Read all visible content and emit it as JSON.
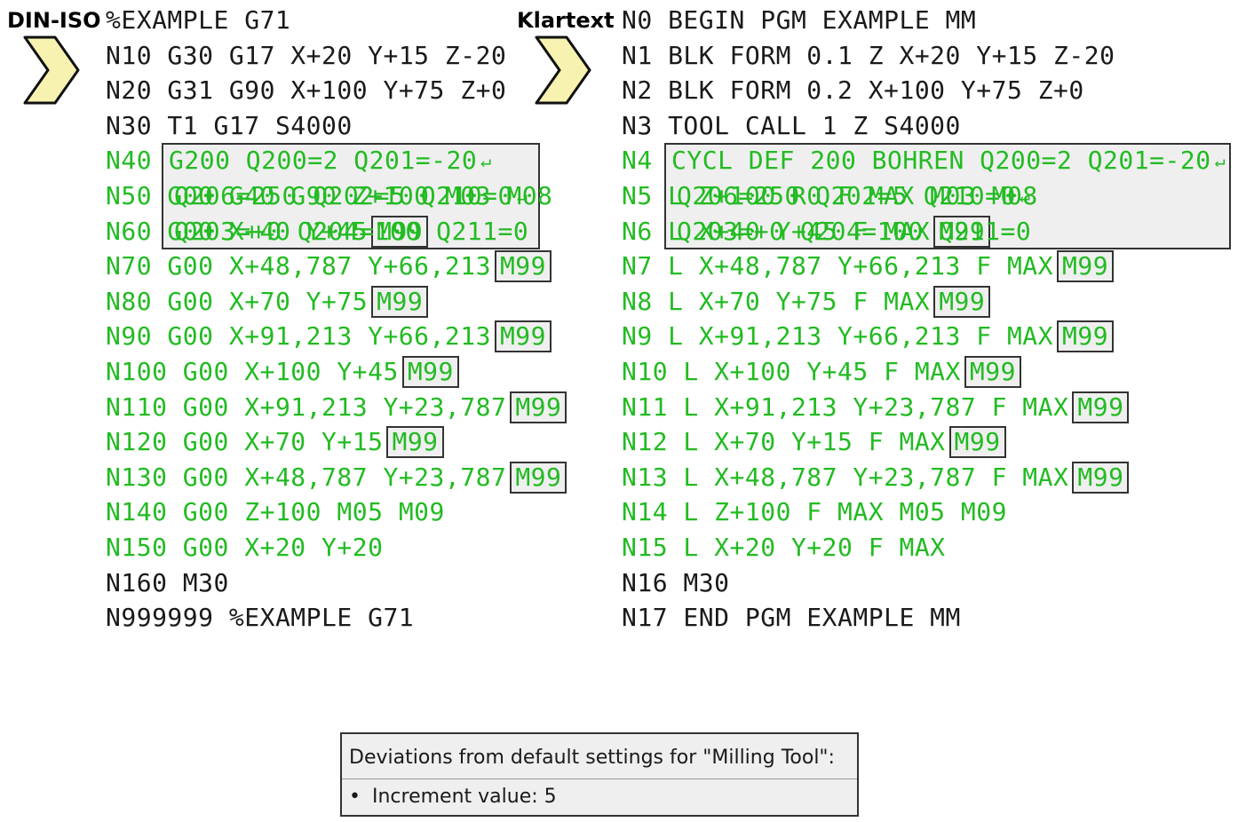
{
  "left": {
    "label": "DIN-ISO",
    "cycle_box": [
      [
        "G200",
        "Q200=2",
        "Q201=-20"
      ],
      [
        "Q206=250",
        "Q202=5",
        "Q210=0"
      ],
      [
        "Q203=+0",
        "Q204=100",
        "Q211=0"
      ]
    ],
    "lines": [
      {
        "color": "black",
        "tokens": [
          "%EXAMPLE",
          "G71"
        ]
      },
      {
        "color": "black",
        "tokens": [
          "N10",
          "G30",
          "G17",
          "X+20",
          "Y+15",
          "Z-20"
        ]
      },
      {
        "color": "black",
        "tokens": [
          "N20",
          "G31",
          "G90",
          "X+100",
          "Y+75",
          "Z+0"
        ]
      },
      {
        "color": "black",
        "tokens": [
          "N30",
          "T1",
          "G17",
          "S4000"
        ]
      },
      {
        "color": "green",
        "tokens": [
          "N40"
        ]
      },
      {
        "color": "green",
        "tokens": [
          "N50",
          "G00",
          "G40",
          "G90",
          "Z+100",
          "M03",
          "M08"
        ]
      },
      {
        "color": "green",
        "tokens": [
          "N60",
          "G00",
          "X+40",
          "Y+45"
        ],
        "boxed": "M99"
      },
      {
        "color": "green",
        "tokens": [
          "N70",
          "G00",
          "X+48,787",
          "Y+66,213"
        ],
        "boxed": "M99"
      },
      {
        "color": "green",
        "tokens": [
          "N80",
          "G00",
          "X+70",
          "Y+75"
        ],
        "boxed": "M99"
      },
      {
        "color": "green",
        "tokens": [
          "N90",
          "G00",
          "X+91,213",
          "Y+66,213"
        ],
        "boxed": "M99"
      },
      {
        "color": "green",
        "tokens": [
          "N100",
          "G00",
          "X+100",
          "Y+45"
        ],
        "boxed": "M99"
      },
      {
        "color": "green",
        "tokens": [
          "N110",
          "G00",
          "X+91,213",
          "Y+23,787"
        ],
        "boxed": "M99"
      },
      {
        "color": "green",
        "tokens": [
          "N120",
          "G00",
          "X+70",
          "Y+15"
        ],
        "boxed": "M99"
      },
      {
        "color": "green",
        "tokens": [
          "N130",
          "G00",
          "X+48,787",
          "Y+23,787"
        ],
        "boxed": "M99"
      },
      {
        "color": "green",
        "tokens": [
          "N140",
          "G00",
          "Z+100",
          "M05",
          "M09"
        ]
      },
      {
        "color": "green",
        "tokens": [
          "N150",
          "G00",
          "X+20",
          "Y+20"
        ]
      },
      {
        "color": "black",
        "tokens": [
          "N160",
          "M30"
        ]
      },
      {
        "color": "black",
        "tokens": [
          "N999999",
          "%EXAMPLE",
          "G71"
        ]
      }
    ]
  },
  "right": {
    "label": "Klartext",
    "cycle_box": [
      [
        "CYCL",
        "DEF",
        "200",
        "BOHREN",
        "Q200=2",
        "Q201=-20"
      ],
      [
        "Q206=250",
        "Q202=5",
        "Q210=0"
      ],
      [
        "Q203=+0",
        "Q204=100",
        "Q211=0"
      ]
    ],
    "lines": [
      {
        "color": "black",
        "tokens": [
          "N0",
          "BEGIN",
          "PGM",
          "EXAMPLE",
          "MM"
        ]
      },
      {
        "color": "black",
        "tokens": [
          "N1",
          "BLK",
          "FORM",
          "0.1",
          "Z",
          "X+20",
          "Y+15",
          "Z-20"
        ]
      },
      {
        "color": "black",
        "tokens": [
          "N2",
          "BLK",
          "FORM",
          "0.2",
          "X+100",
          "Y+75",
          "Z+0"
        ]
      },
      {
        "color": "black",
        "tokens": [
          "N3",
          "TOOL",
          "CALL",
          "1",
          "Z",
          "S4000"
        ]
      },
      {
        "color": "green",
        "tokens": [
          "N4"
        ]
      },
      {
        "color": "green",
        "tokens": [
          "N5",
          "L",
          "Z+100",
          "R0",
          "F",
          "MAX",
          "M03",
          "M08"
        ]
      },
      {
        "color": "green",
        "tokens": [
          "N6",
          "L",
          "X+40",
          "Y+45",
          "F",
          "MAX"
        ],
        "boxed": "M99"
      },
      {
        "color": "green",
        "tokens": [
          "N7",
          "L",
          "X+48,787",
          "Y+66,213",
          "F",
          "MAX"
        ],
        "boxed": "M99"
      },
      {
        "color": "green",
        "tokens": [
          "N8",
          "L",
          "X+70",
          "Y+75",
          "F",
          "MAX"
        ],
        "boxed": "M99"
      },
      {
        "color": "green",
        "tokens": [
          "N9",
          "L",
          "X+91,213",
          "Y+66,213",
          "F",
          "MAX"
        ],
        "boxed": "M99"
      },
      {
        "color": "green",
        "tokens": [
          "N10",
          "L",
          "X+100",
          "Y+45",
          "F",
          "MAX"
        ],
        "boxed": "M99"
      },
      {
        "color": "green",
        "tokens": [
          "N11",
          "L",
          "X+91,213",
          "Y+23,787",
          "F",
          "MAX"
        ],
        "boxed": "M99"
      },
      {
        "color": "green",
        "tokens": [
          "N12",
          "L",
          "X+70",
          "Y+15",
          "F",
          "MAX"
        ],
        "boxed": "M99"
      },
      {
        "color": "green",
        "tokens": [
          "N13",
          "L",
          "X+48,787",
          "Y+23,787",
          "F",
          "MAX"
        ],
        "boxed": "M99"
      },
      {
        "color": "green",
        "tokens": [
          "N14",
          "L",
          "Z+100",
          "F",
          "MAX",
          "M05",
          "M09"
        ]
      },
      {
        "color": "green",
        "tokens": [
          "N15",
          "L",
          "X+20",
          "Y+20",
          "F",
          "MAX"
        ]
      },
      {
        "color": "black",
        "tokens": [
          "N16",
          "M30"
        ]
      },
      {
        "color": "black",
        "tokens": [
          "N17",
          "END",
          "PGM",
          "EXAMPLE",
          "MM"
        ]
      }
    ]
  },
  "colors": {
    "green": "#22bb22",
    "black": "#1a1a1a",
    "box_bg": "#efefef",
    "chevron_fill": "#f7f2b0"
  },
  "icons": {
    "chevron": "chevron-right-icon",
    "return": "return-arrow-icon"
  },
  "note": {
    "title": "Deviations from default settings for \"Milling Tool\":",
    "items": [
      "Increment value: 5"
    ]
  }
}
